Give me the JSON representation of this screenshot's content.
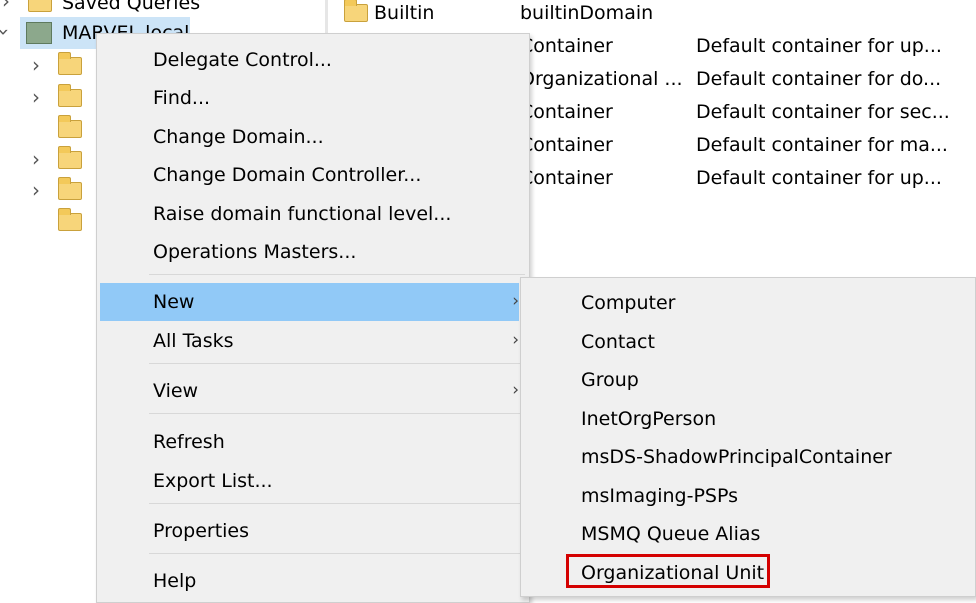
{
  "tree": {
    "saved_queries": "Saved Queries",
    "domain": "MARVEL.local"
  },
  "list": {
    "rows": [
      {
        "name": "Builtin",
        "type": "builtinDomain",
        "desc": ""
      },
      {
        "name": "",
        "type": "Container",
        "desc": "Default container for up..."
      },
      {
        "name": "",
        "type": "Organizational ...",
        "desc": "Default container for do..."
      },
      {
        "name": "",
        "type": "Container",
        "desc": "Default container for sec..."
      },
      {
        "name": "",
        "type": "Container",
        "desc": "Default container for ma..."
      },
      {
        "name": "",
        "type": "Container",
        "desc": "Default container for up..."
      }
    ]
  },
  "context_menu": {
    "items": [
      "Delegate Control...",
      "Find...",
      "Change Domain...",
      "Change Domain Controller...",
      "Raise domain functional level...",
      "Operations Masters...",
      "New",
      "All Tasks",
      "View",
      "Refresh",
      "Export List...",
      "Properties",
      "Help"
    ],
    "submenu_arrow": "›",
    "highlighted": "New"
  },
  "new_submenu": {
    "items": [
      "Computer",
      "Contact",
      "Group",
      "InetOrgPerson",
      "msDS-ShadowPrincipalContainer",
      "msImaging-PSPs",
      "MSMQ Queue Alias",
      "Organizational Unit"
    ],
    "selected": "Organizational Unit"
  },
  "colors": {
    "highlight": "#91c9f7",
    "selection_box": "#d40000",
    "menu_bg": "#f0f0f0"
  }
}
